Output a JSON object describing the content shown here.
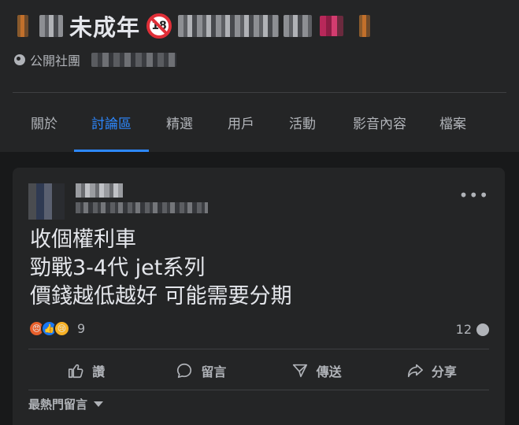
{
  "group": {
    "title": "未成年",
    "adult_badge": "18",
    "privacy_label": "公開社團"
  },
  "tabs": [
    {
      "label": "關於"
    },
    {
      "label": "討論區",
      "active": true
    },
    {
      "label": "精選"
    },
    {
      "label": "用戶"
    },
    {
      "label": "活動"
    },
    {
      "label": "影音內容"
    },
    {
      "label": "檔案"
    }
  ],
  "post": {
    "lines": [
      "收個權利車",
      "勁戰3-4代 jet系列",
      "價錢越低越好 可能需要分期"
    ],
    "reaction_count": "9",
    "reaction_icons": [
      "angry-icon",
      "like-icon",
      "sad-icon"
    ],
    "comment_count": "12",
    "actions": [
      {
        "label": "讚",
        "icon": "thumbs-up-icon"
      },
      {
        "label": "留言",
        "icon": "comment-icon"
      },
      {
        "label": "傳送",
        "icon": "send-icon"
      },
      {
        "label": "分享",
        "icon": "share-icon"
      }
    ],
    "sort_label": "最熱門留言"
  },
  "colors": {
    "accent": "#2d88ff",
    "background": "#18191a",
    "card": "#242526",
    "text": "#e4e6eb",
    "secondary_text": "#b0b3b8"
  }
}
